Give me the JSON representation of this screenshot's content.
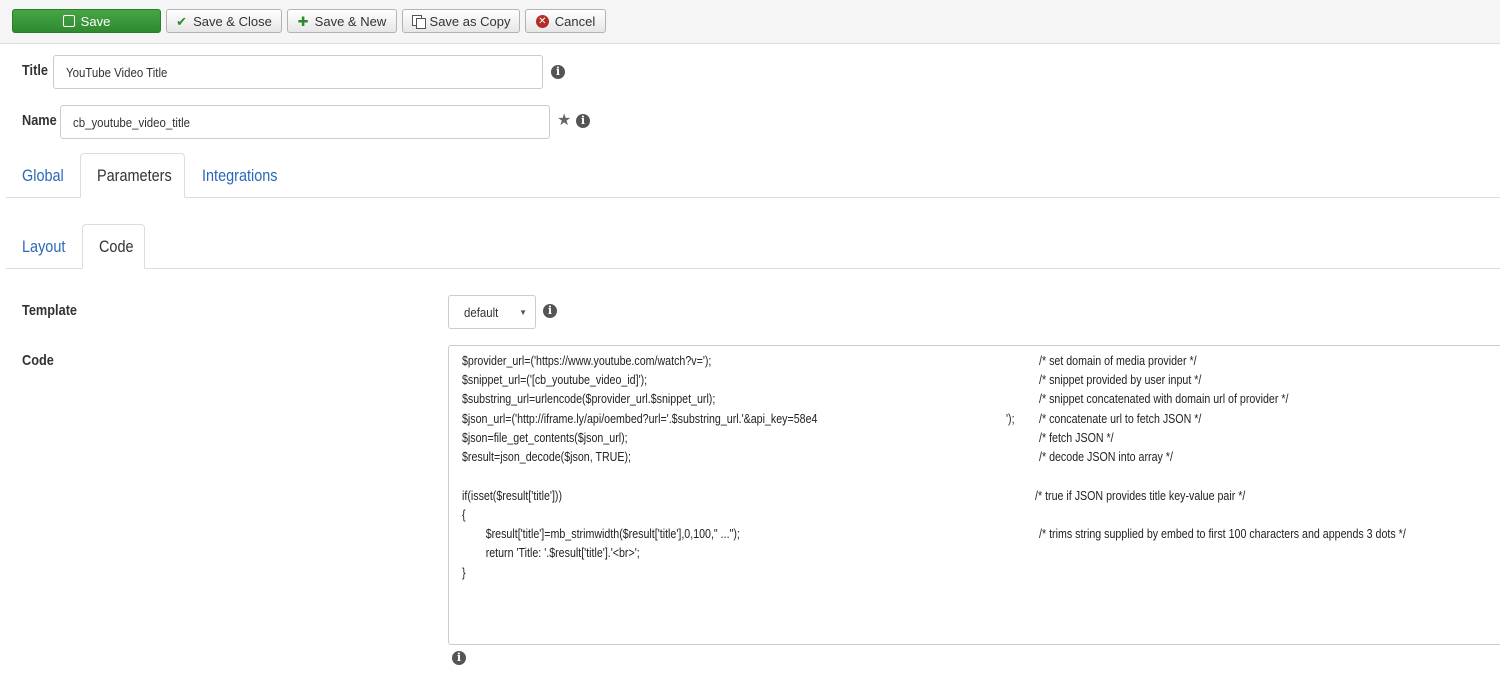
{
  "toolbar": {
    "save": "Save",
    "save_close": "Save & Close",
    "save_new": "Save & New",
    "save_copy": "Save as Copy",
    "cancel": "Cancel"
  },
  "form": {
    "title_label": "Title",
    "title_value": "YouTube Video Title",
    "name_label": "Name",
    "name_value": "cb_youtube_video_title"
  },
  "tabs": [
    "Global",
    "Parameters",
    "Integrations"
  ],
  "subtabs": [
    "Layout",
    "Code"
  ],
  "template": {
    "label": "Template",
    "selected": "default"
  },
  "code": {
    "label": "Code",
    "lines": [
      "$provider_url=('https://www.youtube.com/watch?v=');",
      "$snippet_url=('[cb_youtube_video_id]');",
      "$substring_url=urlencode($provider_url.$snippet_url);",
      "$json_url=('http://iframe.ly/api/oembed?url='.$substring_url.'&api_key=58e4",
      "$json=file_get_contents($json_url);",
      "$result=json_decode($json, TRUE);",
      "",
      "if(isset($result['title']))",
      "{",
      "        $result['title']=mb_strimwidth($result['title'],0,100,\" ...\");",
      "        return 'Title: '.$result['title'].'<br>';",
      "}"
    ],
    "line4_tail": "');",
    "comments": [
      "/* set domain of media provider */",
      "/* snippet provided by user input */",
      "/* snippet concatenated with domain url of provider */",
      "/* concatenate url to fetch JSON */",
      "/* fetch JSON */",
      "/* decode JSON into array */",
      "",
      "/* true if JSON provides title key-value pair */",
      "",
      "/* trims string supplied by embed to first 100 characters and appends 3 dots */",
      "",
      ""
    ]
  },
  "colors": {
    "primary_green": "#2f8a2f",
    "link_blue": "#2a69b8",
    "cancel_red": "#b52b27"
  }
}
